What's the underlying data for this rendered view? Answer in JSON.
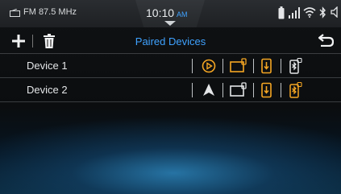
{
  "status_bar": {
    "source_label": "FM 87.5 MHz",
    "time": "10:10",
    "ampm": "AM",
    "icons": [
      "radio-icon",
      "battery-icon",
      "signal-icon",
      "wifi-icon",
      "bluetooth-icon",
      "volume-icon"
    ]
  },
  "toolbar": {
    "title": "Paired Devices",
    "add_icon": "plus-icon",
    "delete_icon": "trash-icon",
    "back_icon": "back-arrow-icon"
  },
  "devices": [
    {
      "name": "Device 1",
      "features": [
        "carplay-icon",
        "phone-screen-icon",
        "phone-icon",
        "bluetooth-audio-icon"
      ]
    },
    {
      "name": "Device 2",
      "features": [
        "android-auto-icon",
        "phone-screen-icon",
        "phone-icon",
        "bluetooth-audio-icon"
      ]
    }
  ],
  "colors": {
    "accent": "#3fa2ff",
    "feature_active": "#f5a623",
    "divider": "#3a3d40"
  }
}
